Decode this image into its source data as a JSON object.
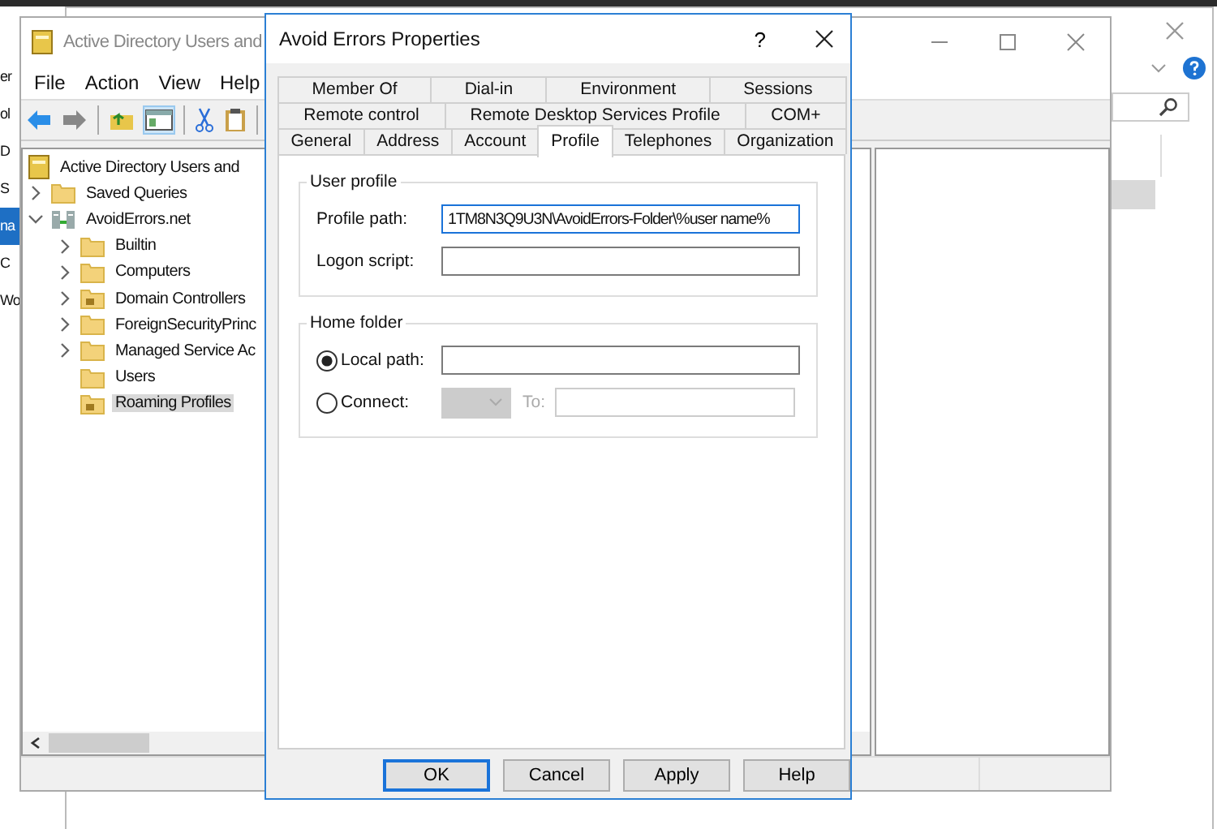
{
  "side_window": {
    "items": [
      {
        "label": "er",
        "selected": false
      },
      {
        "label": "ol",
        "selected": false
      },
      {
        "label": "D",
        "selected": false
      },
      {
        "label": "S",
        "selected": false
      },
      {
        "label": "na",
        "selected": true
      },
      {
        "label": "C",
        "selected": false
      },
      {
        "label": "Wo",
        "selected": false
      }
    ]
  },
  "main_window": {
    "title": "Active Directory Users and",
    "menu": [
      "File",
      "Action",
      "View",
      "Help"
    ],
    "tree": {
      "label": "Active Directory Users and",
      "kind": "root",
      "selected": false,
      "children": [
        {
          "label": "Saved Queries",
          "kind": "folder",
          "expandable": true,
          "expanded": false,
          "selected": false
        },
        {
          "label": "AvoidErrors.net",
          "kind": "domain",
          "expandable": true,
          "expanded": true,
          "selected": false,
          "children": [
            {
              "label": "Builtin",
              "kind": "folder",
              "expandable": true,
              "expanded": false,
              "selected": false
            },
            {
              "label": "Computers",
              "kind": "folder",
              "expandable": true,
              "expanded": false,
              "selected": false
            },
            {
              "label": "Domain Controllers",
              "kind": "ou",
              "expandable": true,
              "expanded": false,
              "selected": false
            },
            {
              "label": "ForeignSecurityPrinc",
              "kind": "folder",
              "expandable": true,
              "expanded": false,
              "selected": false
            },
            {
              "label": "Managed Service Ac",
              "kind": "folder",
              "expandable": true,
              "expanded": false,
              "selected": false
            },
            {
              "label": "Users",
              "kind": "folder",
              "expandable": false,
              "selected": false
            },
            {
              "label": "Roaming Profiles",
              "kind": "ou",
              "expandable": false,
              "selected": true
            }
          ]
        }
      ]
    }
  },
  "dialog": {
    "title": "Avoid Errors Properties",
    "help": "?",
    "tab_rows": [
      [
        {
          "label": "Member Of",
          "selected": false
        },
        {
          "label": "Dial-in",
          "selected": false
        },
        {
          "label": "Environment",
          "selected": false
        },
        {
          "label": "Sessions",
          "selected": false
        }
      ],
      [
        {
          "label": "Remote control",
          "selected": false
        },
        {
          "label": "Remote Desktop Services Profile",
          "selected": false
        },
        {
          "label": "COM+",
          "selected": false
        }
      ],
      [
        {
          "label": "General",
          "selected": false
        },
        {
          "label": "Address",
          "selected": false
        },
        {
          "label": "Account",
          "selected": false
        },
        {
          "label": "Profile",
          "selected": true
        },
        {
          "label": "Telephones",
          "selected": false
        },
        {
          "label": "Organization",
          "selected": false
        }
      ]
    ],
    "user_profile": {
      "title": "User profile",
      "fields": [
        {
          "label": "Profile path:",
          "value": "1TM8N3Q9U3N\\AvoidErrors-Folder\\%user name%",
          "focused": true
        },
        {
          "label": "Logon script:",
          "focused": false
        }
      ]
    },
    "home_folder": {
      "title": "Home folder",
      "options": [
        {
          "kind": "path",
          "label": "Local path:",
          "selected": true
        },
        {
          "kind": "connect",
          "label": "Connect:",
          "selected": false,
          "to_label": "To:"
        }
      ]
    },
    "buttons": [
      {
        "label": "OK",
        "default": true
      },
      {
        "label": "Cancel",
        "default": false
      },
      {
        "label": "Apply",
        "default": false
      },
      {
        "label": "Help",
        "default": false
      }
    ]
  }
}
